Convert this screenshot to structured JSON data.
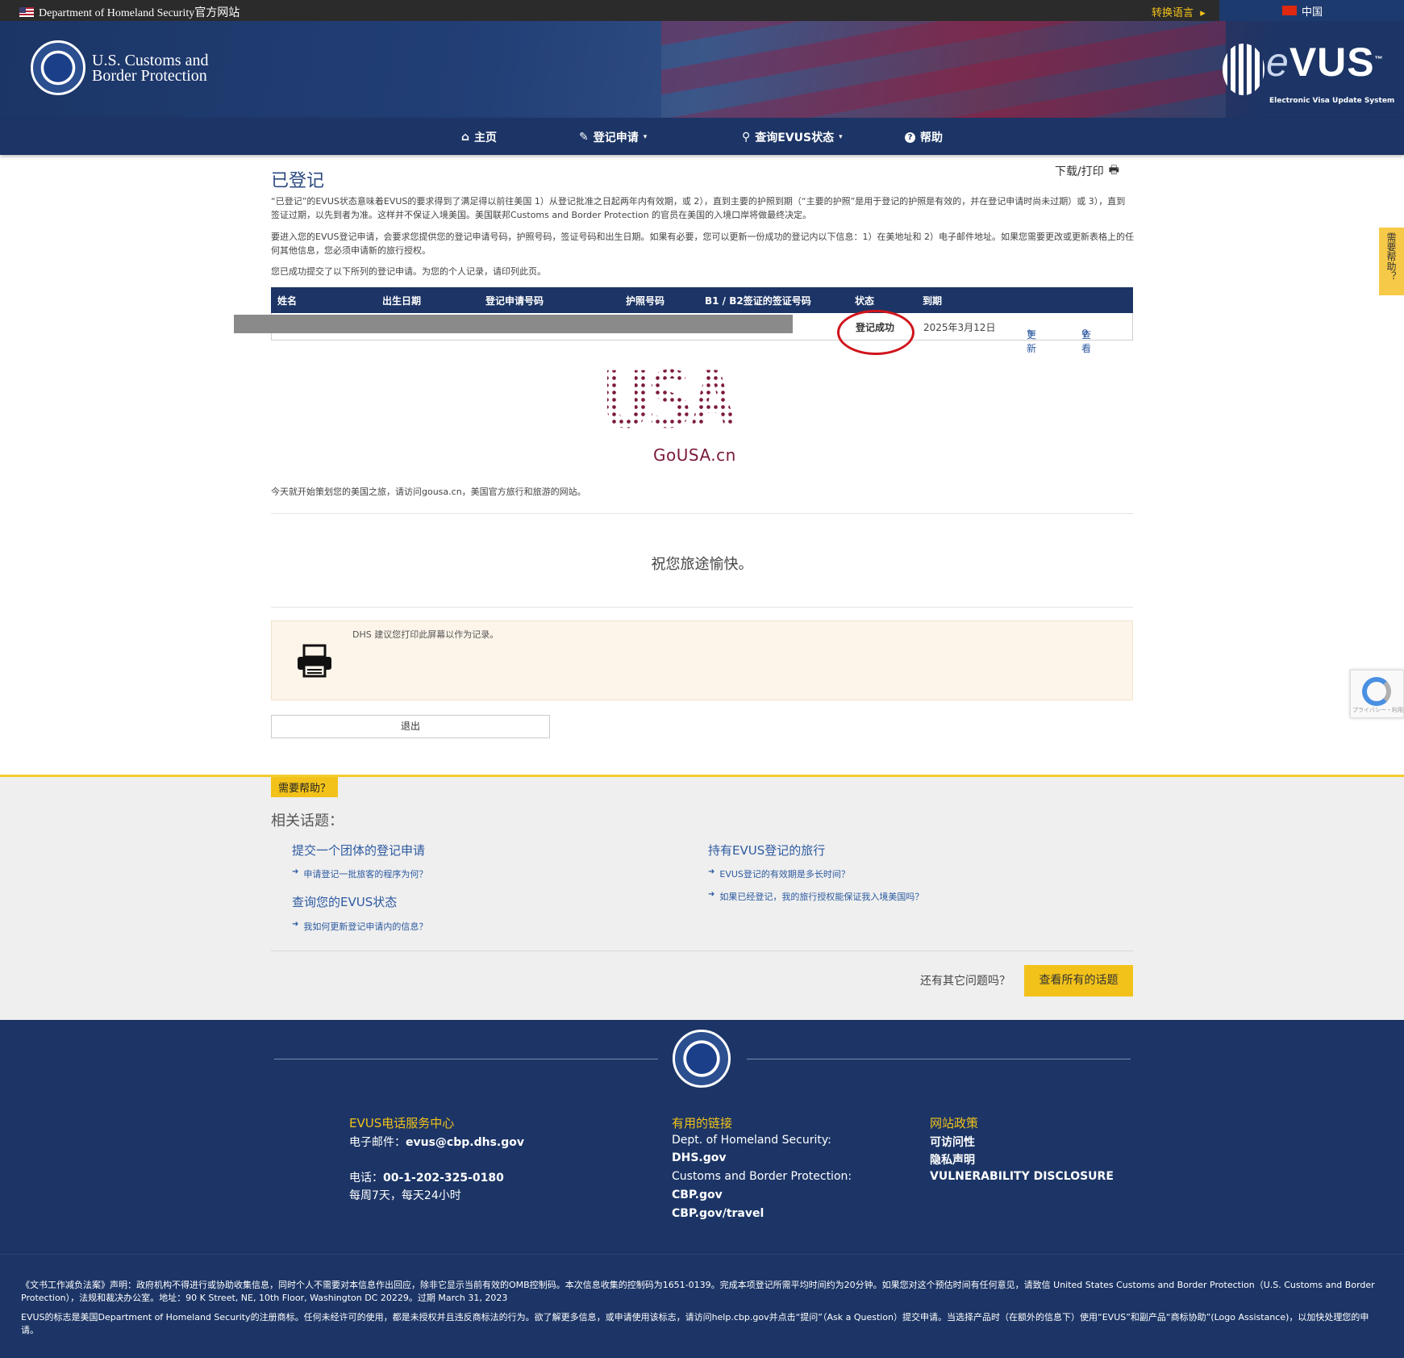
{
  "topbar": {
    "dhs_text": "Department of Homeland Security官方网站",
    "switch_lang": "转换语言",
    "country": "中国"
  },
  "header": {
    "agency_line1": "U.S. Customs and",
    "agency_line2": "Border Protection",
    "logo_word": "VUS",
    "logo_e": "e",
    "logo_sub": "Electronic Visa Update System",
    "logo_tm": "™"
  },
  "nav": [
    {
      "label": "主页",
      "icon": "home-icon",
      "glyph": "⌂"
    },
    {
      "label": "登记申请",
      "icon": "pencil-icon",
      "glyph": "✎",
      "dropdown": true
    },
    {
      "label": "查询EVUS状态",
      "icon": "search-icon",
      "glyph": "⚲",
      "dropdown": true
    },
    {
      "label": "帮助",
      "icon": "question-icon",
      "glyph": "?"
    }
  ],
  "main": {
    "title": "已登记",
    "download": "下载/打印",
    "para1": "“已登记”的EVUS状态意味着EVUS的要求得到了满足得以前往美国 1）从登记批准之日起两年内有效期，或 2），直到主要的护照到期（“主要的护照”是用于登记的护照是有效的，并在登记申请时尚未过期）或 3），直到签证过期，以先到者为准。这样并不保证入境美国。美国联邦Customs and Border Protection 的官员在美国的入境口岸将做最终决定。",
    "para2": "要进入您的EVUS登记申请，会要求您提供您的登记申请号码，护照号码，签证号码和出生日期。如果有必要，您可以更新一份成功的登记内以下信息：1）在美地址和 2）电子邮件地址。如果您需要更改或更新表格上的任何其他信息，您必须申请新的旅行授权。",
    "para3": "您已成功提交了以下所列的登记申请。为您的个人记录，请印列此页。"
  },
  "table": {
    "headers": [
      "姓名",
      "出生日期",
      "登记申请号码",
      "护照号码",
      "B1 / B2签证的签证号码",
      "状态",
      "到期"
    ],
    "row": {
      "status": "登记成功",
      "expiry": "2025年3月12日",
      "update": "更新",
      "view": "查看"
    }
  },
  "promo": {
    "usa": "USA",
    "gousa": "GoUSA.cn",
    "plan_text": "今天就开始策划您的美国之旅，请访问gousa.cn，美国官方旅行和旅游的网站。",
    "bon_voyage": "祝您旅途愉快。"
  },
  "notice": {
    "text": "DHS 建议您打印此屏幕以作为记录。"
  },
  "logout": "退出",
  "side_help": "需要帮助？",
  "recaptcha_label": "プライバシー・利用規約",
  "help": {
    "tag": "需要帮助？",
    "heading": "相关话题：",
    "topic1": "提交一个团体的登记申请",
    "topic1_q1": "申请登记一批旅客的程序为何？",
    "topic2": "查询您的EVUS状态",
    "topic2_q1": "我如何更新登记申请内的信息？",
    "topic3": "持有EVUS登记的旅行",
    "topic3_q1": "EVUS登记的有效期是多长时间？",
    "topic3_q2": "如果已经登记，我的旅行授权能保证我入境美国吗？",
    "more_q": "还有其它问题吗？",
    "all_topics": "查看所有的话题"
  },
  "footer": {
    "col1_title": "EVUS电话服务中心",
    "email_label": "电子邮件：",
    "email": "evus@cbp.dhs.gov",
    "phone_label": "电话：",
    "phone": "00-1-202-325-0180",
    "hours": "每周7天，每天24小时",
    "col2_title": "有用的链接",
    "dhs_label": "Dept. of Homeland Security:",
    "dhs_link": "DHS.gov",
    "cbp_label": "Customs and Border Protection:",
    "cbp_link": "CBP.gov",
    "cbp_travel": "CBP.gov/travel",
    "col3_title": "网站政策",
    "accessibility": "可访问性",
    "privacy": "隐私声明",
    "vuln": "VULNERABILITY DISCLOSURE"
  },
  "legal": {
    "p1": "《文书工作减负法案》声明：政府机构不得进行或协助收集信息，同时个人不需要对本信息作出回应，除非它显示当前有效的OMB控制码。本次信息收集的控制码为1651-0139。完成本项登记所需平均时间约为20分钟。如果您对这个预估时间有任何意见，请致信 United States Customs and Border Protection（U.S. Customs and Border Protection），法规和裁决办公室。地址：90 K Street, NE, 10th Floor, Washington DC 20229。过期 March 31, 2023",
    "p2": "EVUS的标志是美国Department of Homeland Security的注册商标。任何未经许可的使用，都是未授权并且违反商标法的行为。欲了解更多信息，或申请使用该标志，请访问help.cbp.gov并点击“提问”（Ask a Question）提交申请。当选择产品时（在额外的信息下）使用“EVUS”和副产品“商标协助”(Logo Assistance)，以加快处理您的申请。"
  },
  "colors": {
    "navy": "#1c3566",
    "gold": "#f2c21a",
    "status_circle": "#d0141c",
    "gousa": "#7a1a3a"
  }
}
